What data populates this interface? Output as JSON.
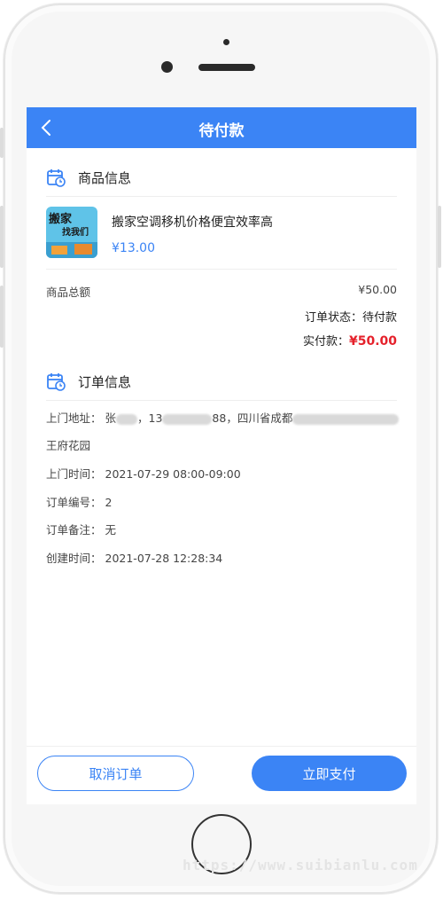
{
  "nav": {
    "title": "待付款"
  },
  "goods_section": {
    "title": "商品信息"
  },
  "product": {
    "name": "搬家空调移机价格便宜效率高",
    "price": "¥13.00",
    "thumb_text_1": "搬家",
    "thumb_text_2": "找我们"
  },
  "summary": {
    "total_label": "商品总额",
    "total_value": "¥50.00",
    "status_label": "订单状态：",
    "status_value": "待付款",
    "paid_label": "实付款：",
    "paid_value": "¥50.00"
  },
  "order_section": {
    "title": "订单信息"
  },
  "order": {
    "address_label": "上门地址：",
    "address_part1": "张",
    "address_part2": "，13",
    "address_part3": "88，四川省成都",
    "address_line2": "王府花园",
    "time_label": "上门时间：",
    "time_value": "2021-07-29 08:00-09:00",
    "number_label": "订单编号：",
    "number_value": "2",
    "remark_label": "订单备注：",
    "remark_value": "无",
    "created_label": "创建时间：",
    "created_value": "2021-07-28 12:28:34"
  },
  "actions": {
    "cancel_label": "取消订单",
    "pay_label": "立即支付"
  },
  "watermark": "https://www.suibianlu.com",
  "colors": {
    "primary": "#3b84f5",
    "price_red": "#e5212b"
  }
}
